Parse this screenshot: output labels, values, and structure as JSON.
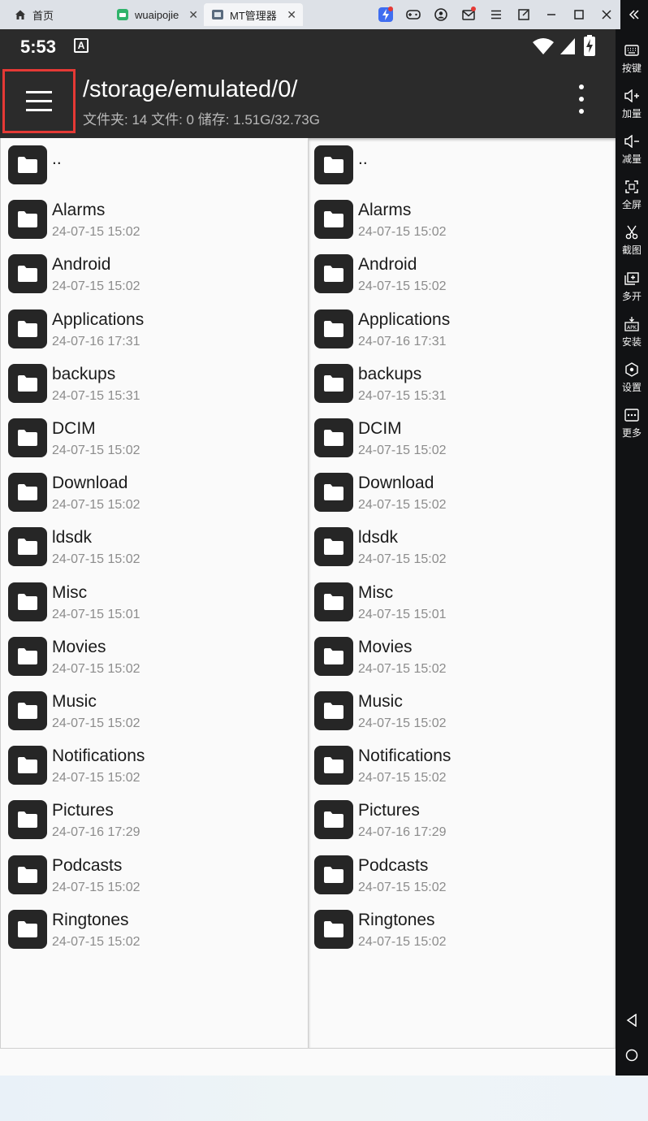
{
  "emulator": {
    "tabs": [
      {
        "label": "首页"
      },
      {
        "label": "wuaipojie"
      },
      {
        "label": "MT管理器"
      }
    ],
    "sidebar": [
      {
        "label": "按键",
        "icon": "keyboard-icon"
      },
      {
        "label": "加量",
        "icon": "volume-up-icon"
      },
      {
        "label": "减量",
        "icon": "volume-down-icon"
      },
      {
        "label": "全屏",
        "icon": "fullscreen-icon"
      },
      {
        "label": "截图",
        "icon": "scissors-icon"
      },
      {
        "label": "多开",
        "icon": "multi-instance-icon"
      },
      {
        "label": "安装",
        "icon": "apk-install-icon"
      },
      {
        "label": "设置",
        "icon": "settings-icon"
      },
      {
        "label": "更多",
        "icon": "more-icon"
      }
    ]
  },
  "status": {
    "time": "5:53",
    "badge": "A"
  },
  "appbar": {
    "path": "/storage/emulated/0/",
    "info": "文件夹: 14  文件: 0  储存: 1.51G/32.73G"
  },
  "files": [
    {
      "name": "..",
      "date": ""
    },
    {
      "name": "Alarms",
      "date": "24-07-15 15:02"
    },
    {
      "name": "Android",
      "date": "24-07-15 15:02"
    },
    {
      "name": "Applications",
      "date": "24-07-16 17:31"
    },
    {
      "name": "backups",
      "date": "24-07-15 15:31"
    },
    {
      "name": "DCIM",
      "date": "24-07-15 15:02"
    },
    {
      "name": "Download",
      "date": "24-07-15 15:02"
    },
    {
      "name": "ldsdk",
      "date": "24-07-15 15:02"
    },
    {
      "name": "Misc",
      "date": "24-07-15 15:01"
    },
    {
      "name": "Movies",
      "date": "24-07-15 15:02"
    },
    {
      "name": "Music",
      "date": "24-07-15 15:02"
    },
    {
      "name": "Notifications",
      "date": "24-07-15 15:02"
    },
    {
      "name": "Pictures",
      "date": "24-07-16 17:29"
    },
    {
      "name": "Podcasts",
      "date": "24-07-15 15:02"
    },
    {
      "name": "Ringtones",
      "date": "24-07-15 15:02"
    }
  ]
}
